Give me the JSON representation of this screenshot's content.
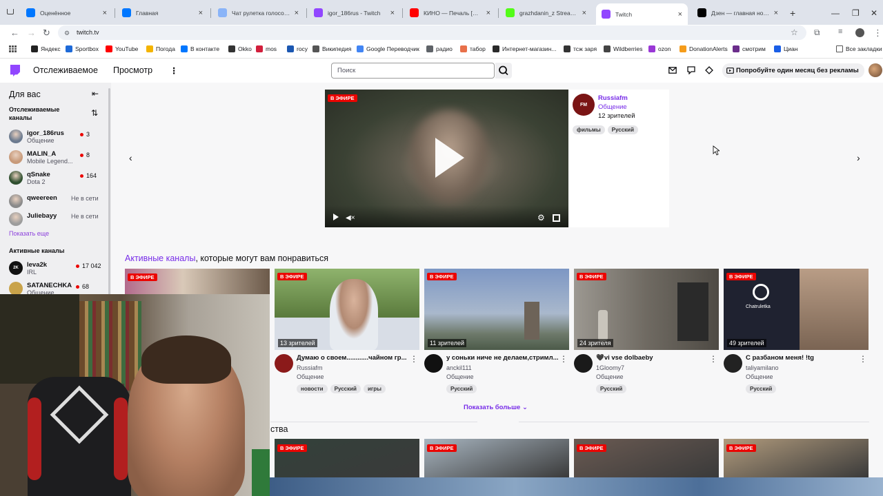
{
  "browser": {
    "tabs": [
      {
        "title": "Оценённое",
        "color": "#0077ff",
        "glyph": "vk"
      },
      {
        "title": "Главная",
        "color": "#0077ff",
        "glyph": "vk"
      },
      {
        "title": "Чат рулетка голосовая –",
        "color": "#8ab4f8",
        "glyph": "doc"
      },
      {
        "title": "igor_186rus - Twitch",
        "color": "#9146ff",
        "glyph": "tw"
      },
      {
        "title": "КИНО — Печаль [Ремей",
        "color": "#ff0000",
        "glyph": "yt"
      },
      {
        "title": "grazhdanin_z Stream - W",
        "color": "#53fc18",
        "glyph": "K"
      },
      {
        "title": "Twitch",
        "color": "#9146ff",
        "glyph": "tw"
      },
      {
        "title": "Дзен — главная новост",
        "color": "#000000",
        "glyph": "dz"
      }
    ],
    "url": "twitch.tv",
    "bookmarks": [
      {
        "label": "Яндекс",
        "color": "#222"
      },
      {
        "label": "Sportbox",
        "color": "#1e6ad8"
      },
      {
        "label": "YouTube",
        "color": "#ff0000"
      },
      {
        "label": "Погода",
        "color": "#f4b400"
      },
      {
        "label": "В контакте",
        "color": "#0077ff"
      },
      {
        "label": "Okko",
        "color": "#333"
      },
      {
        "label": "mos",
        "color": "#d21f3c"
      },
      {
        "label": "rocy",
        "color": "#1b57b1"
      },
      {
        "label": "Википедия",
        "color": "#555"
      },
      {
        "label": "Google Переводчик",
        "color": "#4285f4"
      },
      {
        "label": "радио",
        "color": "#5f6368"
      },
      {
        "label": "табор",
        "color": "#e8704a"
      },
      {
        "label": "Интернет-магазин...",
        "color": "#2a2a2a"
      },
      {
        "label": "тсж заря",
        "color": "#333"
      },
      {
        "label": "Wildberries",
        "color": "#444"
      },
      {
        "label": "ozon",
        "color": "#9a38d6"
      },
      {
        "label": "DonationAlerts",
        "color": "#f59c1a"
      },
      {
        "label": "смотрим",
        "color": "#6b2d8b"
      },
      {
        "label": "Циан",
        "color": "#1a5ee6"
      }
    ],
    "all_bookmarks": "Все закладки"
  },
  "twitch": {
    "nav": {
      "following": "Отслеживаемое",
      "browse": "Просмотр",
      "more": "⋮"
    },
    "search_placeholder": "Поиск",
    "promo": "Попробуйте один месяц без рекламы"
  },
  "sidebar": {
    "for_you": "Для вас",
    "followed_title_1": "Отслеживаемые",
    "followed_title_2": "каналы",
    "followed": [
      {
        "name": "igor_186rus",
        "game": "Общение",
        "viewers": "3",
        "color": "#6b7a8f"
      },
      {
        "name": "MALIN_A",
        "game": "Mobile Legend...",
        "viewers": "8",
        "color": "#c89a7a"
      },
      {
        "name": "qSnake",
        "game": "Dota 2",
        "viewers": "164",
        "color": "#2f4f2f"
      },
      {
        "name": "qweereen",
        "status": "Не в сети",
        "color": "#8a8a8a"
      },
      {
        "name": "Juliebayy",
        "status": "Не в сети",
        "color": "#9c9c9c"
      }
    ],
    "show_more": "Показать еще",
    "active_title": "Активные каналы",
    "active": [
      {
        "name": "leva2k",
        "game": "IRL",
        "viewers": "17 042",
        "color": "#111",
        "badge": "2K"
      },
      {
        "name": "SATANECHKA",
        "game": "Общение",
        "viewers": "68",
        "color": "#c9a34a"
      }
    ]
  },
  "featured": {
    "live": "В ЭФИРЕ",
    "channel": "Russiafm",
    "category": "Общение",
    "viewers": "12 зрителей",
    "tags": [
      "фильмы",
      "Русский"
    ],
    "avatar_text": "FM"
  },
  "section": {
    "title_link": "Активные каналы",
    "title_rest": ", которые могут вам понравиться",
    "show_more": "Показать больше",
    "second_title_tail": "ства"
  },
  "cards": [
    {
      "title": "Думаю о своем............чайном гр...",
      "channel": "Russiafm",
      "category": "Общение",
      "viewers": "13 зрителей",
      "tags": [
        "новости",
        "Русский",
        "игры"
      ],
      "bg": "#6b8a54",
      "av": "#8b1a1a"
    },
    {
      "title": "у соньки ниче не делаем,стримл...",
      "channel": "anckil111",
      "category": "Общение",
      "viewers": "11 зрителей",
      "tags": [
        "Русский"
      ],
      "bg": "#8a9bb5",
      "av": "#111"
    },
    {
      "title": "🖤vi vse dolbaeby",
      "channel": "1Gloomy7",
      "category": "Общение",
      "viewers": "24 зрителя",
      "tags": [
        "Русский"
      ],
      "bg": "#7a7670",
      "av": "#1a1a1a"
    },
    {
      "title": "С разбаном меня! !tg",
      "channel": "taliyamilano",
      "category": "Общение",
      "viewers": "49 зрителей",
      "tags": [
        "Русский"
      ],
      "bg": "#2b2b30",
      "av": "#222"
    }
  ],
  "cards2": [
    {
      "bg": "#33413a"
    },
    {
      "bg": "#a7b4bf"
    },
    {
      "bg": "#6a5a52"
    },
    {
      "bg": "#b09a7c"
    }
  ],
  "partial_card": {
    "live": "В ЭФИРЕ"
  },
  "thumb_app_label": "Chatruletka"
}
